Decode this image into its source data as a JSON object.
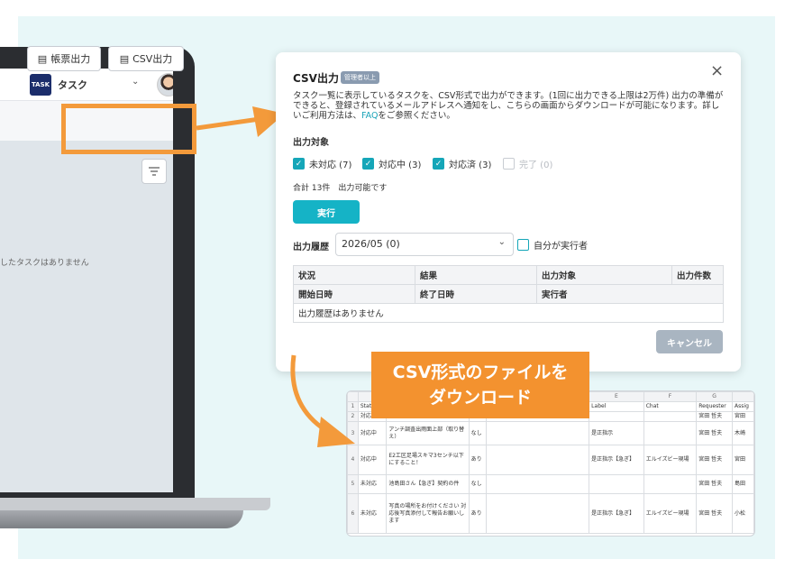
{
  "app": {
    "logo_text": "TASK",
    "title": "タスク",
    "ledger_button": "帳票出力",
    "csv_button": "CSV出力",
    "empty_message": "したタスクはありません"
  },
  "modal": {
    "title": "CSV出力",
    "badge": "管理者以上",
    "close": "×",
    "description_before": "タスク一覧に表示しているタスクを、CSV形式で出力ができます。(1回に出力できる上限は2万件) 出力の準備ができると、登録されているメールアドレスへ通知をし、こちらの画面からダウンロードが可能になります。詳しいご利用方法は、",
    "description_link": "FAQ",
    "description_after": "をご参照ください。",
    "target_label": "出力対象",
    "checkboxes": [
      {
        "label": "未対応 (7)",
        "checked": true
      },
      {
        "label": "対応中 (3)",
        "checked": true
      },
      {
        "label": "対応済 (3)",
        "checked": true
      },
      {
        "label": "完了 (0)",
        "checked": false
      }
    ],
    "total_text": "合計 13件　出力可能です",
    "run_button": "実行",
    "history_label": "出力履歴",
    "history_select": "2026/05 (0)",
    "self_checkbox": "自分が実行者",
    "table_headers_row1": [
      "状況",
      "結果",
      "出力対象",
      "出力件数"
    ],
    "table_headers_row2": [
      "開始日時",
      "終了日時",
      "実行者"
    ],
    "table_empty": "出力履歴はありません",
    "cancel_button": "キャンセル"
  },
  "callout": {
    "line1": "CSV形式のファイルを",
    "line2": "ダウンロード"
  },
  "sheet": {
    "columns": [
      "",
      "",
      "",
      "",
      "",
      "E",
      "F",
      "G",
      ""
    ],
    "rows": [
      {
        "num": "1",
        "cells": [
          "Stat",
          "",
          "",
          "",
          "Label",
          "Chat",
          "Requester",
          "Assig"
        ]
      },
      {
        "num": "2",
        "cells": [
          "対応",
          "",
          "",
          "",
          "",
          "",
          "宮田 哲夫",
          "宮田"
        ]
      },
      {
        "num": "3",
        "cells": [
          "対応中",
          "アンチ調査出雨面上部（取り替え）",
          "なし",
          "",
          "是正指示",
          "",
          "宮田 哲夫",
          "木崎"
        ]
      },
      {
        "num": "4",
        "cells": [
          "対応中",
          "E2工区足場スキマ3センチ以下にすること！",
          "あり",
          "",
          "是正指示【急ぎ】",
          "エルイズビー現場",
          "宮田 哲夫",
          "宮田"
        ]
      },
      {
        "num": "5",
        "cells": [
          "未対応",
          "池島田さん【急ぎ】契約の件",
          "なし",
          "",
          "",
          "",
          "宮田 哲夫",
          "島田"
        ]
      },
      {
        "num": "6",
        "cells": [
          "未対応",
          "写真の場所をお付けください 対応後写真添付して報告お願いします",
          "あり",
          "",
          "是正指示【急ぎ】",
          "エルイズビー現場",
          "宮田 哲夫",
          "小松"
        ]
      }
    ]
  }
}
